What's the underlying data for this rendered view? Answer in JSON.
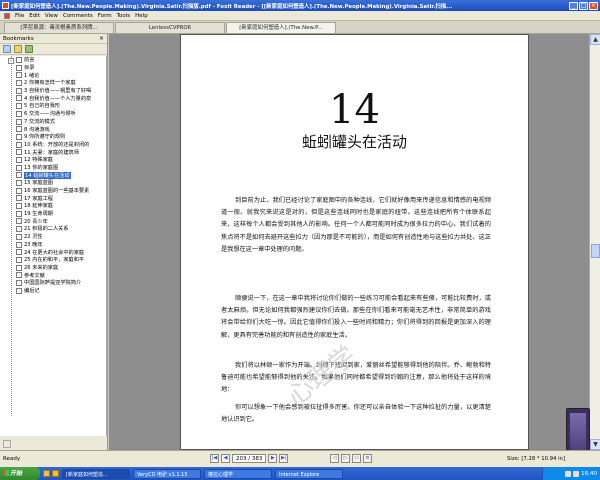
{
  "window": {
    "title": "[新家庭如何塑造人].(The.New.People.Making).Virginia.Satir.扫描版.pdf - Foxit Reader - [[新家庭如何塑造人].(The.New.People.Making).Virginia.Satir.扫描..."
  },
  "menu": [
    "File",
    "Edit",
    "View",
    "Comments",
    "Form",
    "Tools",
    "Help"
  ],
  "tabs": [
    {
      "label": "[萍尼泉源：毒灵根素质系列牌..."
    },
    {
      "label": "LenlessCVPRO6"
    },
    {
      "label": "[新家庭如何塑造人].(The.New.P..."
    }
  ],
  "sidebar": {
    "title": "Bookmarks",
    "close": "×",
    "items": [
      {
        "label": "前言"
      },
      {
        "label": "目录"
      },
      {
        "label": "1 绪论"
      },
      {
        "label": "2 你拥有怎样一个家庭"
      },
      {
        "label": "3 自我价值——锅里有了好喝"
      },
      {
        "label": "4 自我价值——个人力量的泉"
      },
      {
        "label": "5 自己的自我形"
      },
      {
        "label": "6 交流——沟通与倾听"
      },
      {
        "label": "7 交流的模式"
      },
      {
        "label": "8 沟通游戏"
      },
      {
        "label": "9 你所遵守的规则"
      },
      {
        "label": "10 系统：开放的还是封闭的"
      },
      {
        "label": "11 夫妻：家庭的建筑师"
      },
      {
        "label": "12 特殊家庭"
      },
      {
        "label": "13 你的家庭图"
      },
      {
        "label": "14 蚯蚓罐头在活动",
        "selected": true
      },
      {
        "label": "15 家庭蓝图"
      },
      {
        "label": "16 家庭蓝图的一些基本要素"
      },
      {
        "label": "17 家庭工程"
      },
      {
        "label": "18 延伸家庭"
      },
      {
        "label": "19 生命周期"
      },
      {
        "label": "20 青少年"
      },
      {
        "label": "21 积极的二人关系"
      },
      {
        "label": "22 灵性"
      },
      {
        "label": "23 晚年"
      },
      {
        "label": "24 在更大的社会中的家庭"
      },
      {
        "label": "25 内在的和平，家庭和平"
      },
      {
        "label": "26 未来的家庭"
      },
      {
        "label": "参考文献"
      },
      {
        "label": "中国国际萨提亚学院简介"
      },
      {
        "label": "编后记"
      }
    ]
  },
  "document": {
    "chapter_number": "14",
    "chapter_title": "蚯蚓罐头在活动",
    "paragraphs": [
      "到目前为止，我们已经讨论了家庭图中的各种连线，它们就好像用来传递信息和情感的电视频道一般。就我究来说这是对的，但是这些连线同时也是家庭的纽带。这些连线把所有个体联系起来，这样每个人都会受到其他人的影响。任何一个人都可能同时成为很多拉力的中心。我们试着的焦点将不是如何去避开这些拉力（因为那是不可能的），而是如何有创造性地与这些拉力共处。这正是我想在这一章中处理的问题。",
      "顺便说一下，在这一章中我将讨论你们做的一些练习可能会看起来有些傻，可能比较费时，或者太麻烦。但无论如何我都强烈建议你们去做。那些在你们看来可能毫无艺术性，非常简单的游戏将会带给你们大吃一惊。因此它值得你们投入一些时间和精力；你们将得到的回报是更加深入的理解，更具有完善功能的和有创造性的家庭生活。",
      "我们将以林顿一家作为开端。约翰下班回到家，爱丽丝希望能够得到他的陪伴。乔、鲍勃和特鲁迪可能也希望能够得到他的关注。如果他们同时都希望得到约翰的注意，那么他将处于这样的境地：",
      "你可以想象一下他会感到被拉扯得多厉害。你还可以亲自体验一下这种拉扯的力量，以更清楚地认识到它。"
    ]
  },
  "watermark": "心理学",
  "status": {
    "ready": "Ready",
    "page_current": "203",
    "page_total": "383",
    "page_display": "203 / 383",
    "size": "Size: [7.28 * 10.94 in]"
  },
  "taskbar": {
    "start": "开始",
    "items": [
      {
        "label": "[新家庭如何塑造..."
      },
      {
        "label": "VeryCD 电驴 v1.1.15"
      },
      {
        "label": "蓬拉心理学"
      },
      {
        "label": "Internet Explore"
      }
    ],
    "clock": "16:40"
  },
  "colors": {
    "titlebar": "#1b4cbc",
    "selection": "#316ac5",
    "doc_background": "#8e8e8e",
    "start_button": "#3a9a37"
  }
}
